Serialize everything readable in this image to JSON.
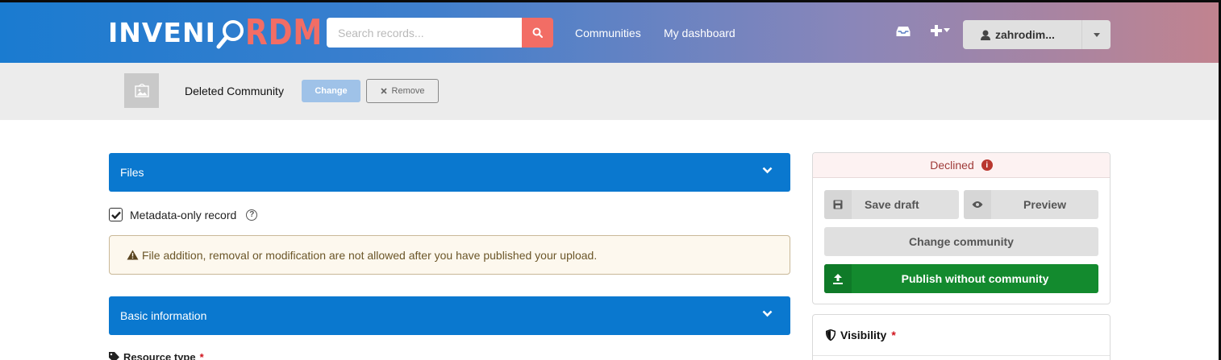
{
  "header": {
    "logo_left": "INVENI",
    "logo_right": "RDM",
    "search_placeholder": "Search records...",
    "nav": [
      "Communities",
      "My dashboard"
    ],
    "user_name": "zahrodim...",
    "colors": {
      "accent": "#f26d65",
      "primary": "#0a78cf"
    }
  },
  "community": {
    "name": "Deleted Community",
    "change_label": "Change",
    "remove_label": "Remove"
  },
  "main": {
    "files_title": "Files",
    "metadata_only_label": "Metadata-only record",
    "metadata_only_checked": true,
    "warning_text": "File addition, removal or modification are not allowed after you have published your upload.",
    "basic_info_title": "Basic information",
    "resource_type_label": "Resource type"
  },
  "sidebar": {
    "status": "Declined",
    "save_draft": "Save draft",
    "preview": "Preview",
    "change_community": "Change community",
    "publish": "Publish without community",
    "visibility_title": "Visibility"
  }
}
